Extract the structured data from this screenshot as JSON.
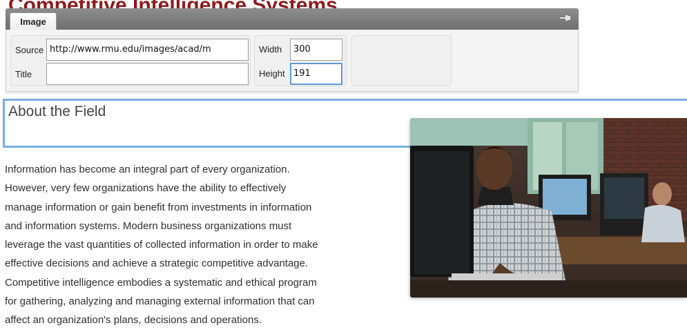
{
  "page": {
    "heading": "Competitive Intelligence Systems"
  },
  "image_toolbar": {
    "tab_label": "Image",
    "pin_icon": "pin-icon",
    "source_label": "Source",
    "source_value": "http://www.rmu.edu/images/acad/m",
    "title_label": "Title",
    "title_value": "",
    "width_label": "Width",
    "width_value": "300",
    "height_label": "Height",
    "height_value": "191",
    "focus_color": "#5d9ad6"
  },
  "content": {
    "section_title": "About the Field",
    "paragraph_lines": [
      "Information has become an integral part of every organization.",
      "However, very few organizations have the ability to effectively",
      "manage information or gain benefit from investments in information",
      "and information systems. Modern business organizations must",
      "leverage the vast quantities of collected information in order to make",
      "effective decisions and achieve a strategic competitive advantage.",
      "Competitive intelligence embodies a systematic and ethical program",
      "for gathering, analyzing and managing external information that can",
      "affect an organization's plans, decisions and operations."
    ],
    "selection_border_color": "#78aee0",
    "heading_color": "#8b1c1c"
  }
}
